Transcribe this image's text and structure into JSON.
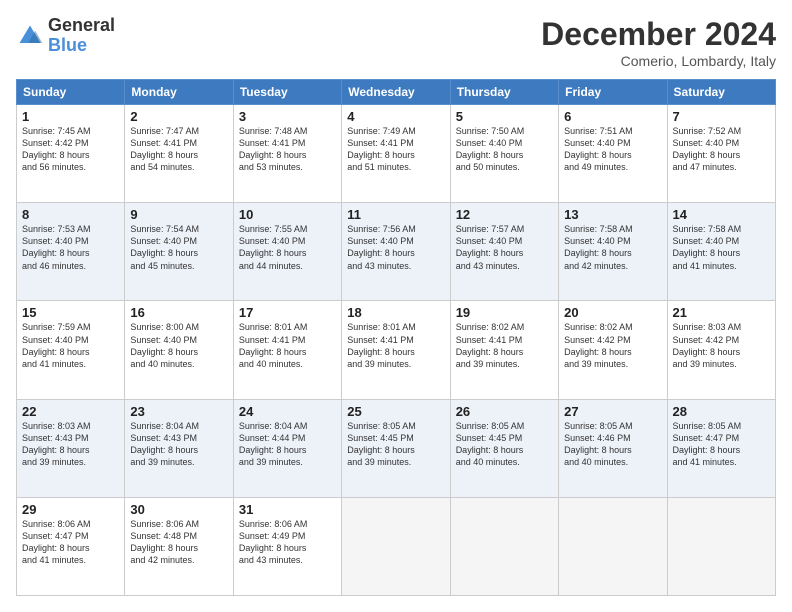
{
  "logo": {
    "line1": "General",
    "line2": "Blue"
  },
  "title": "December 2024",
  "subtitle": "Comerio, Lombardy, Italy",
  "days_header": [
    "Sunday",
    "Monday",
    "Tuesday",
    "Wednesday",
    "Thursday",
    "Friday",
    "Saturday"
  ],
  "weeks": [
    [
      {
        "day": "1",
        "lines": [
          "Sunrise: 7:45 AM",
          "Sunset: 4:42 PM",
          "Daylight: 8 hours",
          "and 56 minutes."
        ]
      },
      {
        "day": "2",
        "lines": [
          "Sunrise: 7:47 AM",
          "Sunset: 4:41 PM",
          "Daylight: 8 hours",
          "and 54 minutes."
        ]
      },
      {
        "day": "3",
        "lines": [
          "Sunrise: 7:48 AM",
          "Sunset: 4:41 PM",
          "Daylight: 8 hours",
          "and 53 minutes."
        ]
      },
      {
        "day": "4",
        "lines": [
          "Sunrise: 7:49 AM",
          "Sunset: 4:41 PM",
          "Daylight: 8 hours",
          "and 51 minutes."
        ]
      },
      {
        "day": "5",
        "lines": [
          "Sunrise: 7:50 AM",
          "Sunset: 4:40 PM",
          "Daylight: 8 hours",
          "and 50 minutes."
        ]
      },
      {
        "day": "6",
        "lines": [
          "Sunrise: 7:51 AM",
          "Sunset: 4:40 PM",
          "Daylight: 8 hours",
          "and 49 minutes."
        ]
      },
      {
        "day": "7",
        "lines": [
          "Sunrise: 7:52 AM",
          "Sunset: 4:40 PM",
          "Daylight: 8 hours",
          "and 47 minutes."
        ]
      }
    ],
    [
      {
        "day": "8",
        "lines": [
          "Sunrise: 7:53 AM",
          "Sunset: 4:40 PM",
          "Daylight: 8 hours",
          "and 46 minutes."
        ]
      },
      {
        "day": "9",
        "lines": [
          "Sunrise: 7:54 AM",
          "Sunset: 4:40 PM",
          "Daylight: 8 hours",
          "and 45 minutes."
        ]
      },
      {
        "day": "10",
        "lines": [
          "Sunrise: 7:55 AM",
          "Sunset: 4:40 PM",
          "Daylight: 8 hours",
          "and 44 minutes."
        ]
      },
      {
        "day": "11",
        "lines": [
          "Sunrise: 7:56 AM",
          "Sunset: 4:40 PM",
          "Daylight: 8 hours",
          "and 43 minutes."
        ]
      },
      {
        "day": "12",
        "lines": [
          "Sunrise: 7:57 AM",
          "Sunset: 4:40 PM",
          "Daylight: 8 hours",
          "and 43 minutes."
        ]
      },
      {
        "day": "13",
        "lines": [
          "Sunrise: 7:58 AM",
          "Sunset: 4:40 PM",
          "Daylight: 8 hours",
          "and 42 minutes."
        ]
      },
      {
        "day": "14",
        "lines": [
          "Sunrise: 7:58 AM",
          "Sunset: 4:40 PM",
          "Daylight: 8 hours",
          "and 41 minutes."
        ]
      }
    ],
    [
      {
        "day": "15",
        "lines": [
          "Sunrise: 7:59 AM",
          "Sunset: 4:40 PM",
          "Daylight: 8 hours",
          "and 41 minutes."
        ]
      },
      {
        "day": "16",
        "lines": [
          "Sunrise: 8:00 AM",
          "Sunset: 4:40 PM",
          "Daylight: 8 hours",
          "and 40 minutes."
        ]
      },
      {
        "day": "17",
        "lines": [
          "Sunrise: 8:01 AM",
          "Sunset: 4:41 PM",
          "Daylight: 8 hours",
          "and 40 minutes."
        ]
      },
      {
        "day": "18",
        "lines": [
          "Sunrise: 8:01 AM",
          "Sunset: 4:41 PM",
          "Daylight: 8 hours",
          "and 39 minutes."
        ]
      },
      {
        "day": "19",
        "lines": [
          "Sunrise: 8:02 AM",
          "Sunset: 4:41 PM",
          "Daylight: 8 hours",
          "and 39 minutes."
        ]
      },
      {
        "day": "20",
        "lines": [
          "Sunrise: 8:02 AM",
          "Sunset: 4:42 PM",
          "Daylight: 8 hours",
          "and 39 minutes."
        ]
      },
      {
        "day": "21",
        "lines": [
          "Sunrise: 8:03 AM",
          "Sunset: 4:42 PM",
          "Daylight: 8 hours",
          "and 39 minutes."
        ]
      }
    ],
    [
      {
        "day": "22",
        "lines": [
          "Sunrise: 8:03 AM",
          "Sunset: 4:43 PM",
          "Daylight: 8 hours",
          "and 39 minutes."
        ]
      },
      {
        "day": "23",
        "lines": [
          "Sunrise: 8:04 AM",
          "Sunset: 4:43 PM",
          "Daylight: 8 hours",
          "and 39 minutes."
        ]
      },
      {
        "day": "24",
        "lines": [
          "Sunrise: 8:04 AM",
          "Sunset: 4:44 PM",
          "Daylight: 8 hours",
          "and 39 minutes."
        ]
      },
      {
        "day": "25",
        "lines": [
          "Sunrise: 8:05 AM",
          "Sunset: 4:45 PM",
          "Daylight: 8 hours",
          "and 39 minutes."
        ]
      },
      {
        "day": "26",
        "lines": [
          "Sunrise: 8:05 AM",
          "Sunset: 4:45 PM",
          "Daylight: 8 hours",
          "and 40 minutes."
        ]
      },
      {
        "day": "27",
        "lines": [
          "Sunrise: 8:05 AM",
          "Sunset: 4:46 PM",
          "Daylight: 8 hours",
          "and 40 minutes."
        ]
      },
      {
        "day": "28",
        "lines": [
          "Sunrise: 8:05 AM",
          "Sunset: 4:47 PM",
          "Daylight: 8 hours",
          "and 41 minutes."
        ]
      }
    ],
    [
      {
        "day": "29",
        "lines": [
          "Sunrise: 8:06 AM",
          "Sunset: 4:47 PM",
          "Daylight: 8 hours",
          "and 41 minutes."
        ]
      },
      {
        "day": "30",
        "lines": [
          "Sunrise: 8:06 AM",
          "Sunset: 4:48 PM",
          "Daylight: 8 hours",
          "and 42 minutes."
        ]
      },
      {
        "day": "31",
        "lines": [
          "Sunrise: 8:06 AM",
          "Sunset: 4:49 PM",
          "Daylight: 8 hours",
          "and 43 minutes."
        ]
      },
      null,
      null,
      null,
      null
    ]
  ]
}
